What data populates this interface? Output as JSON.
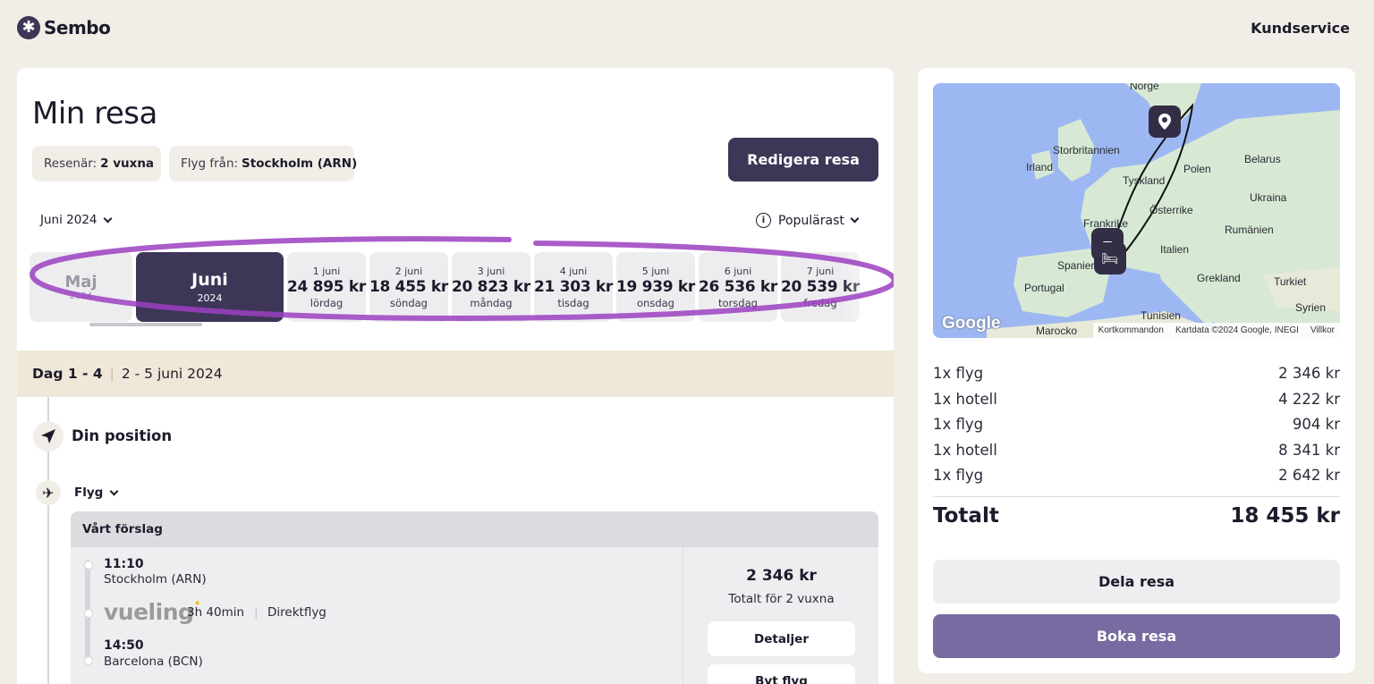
{
  "header": {
    "logo_text": "Sembo",
    "customer_service": "Kundservice"
  },
  "trip": {
    "title": "Min resa",
    "travelers_label": "Resenär:",
    "travelers_value": "2 vuxna",
    "from_label": "Flyg från:",
    "from_value": "Stockholm (ARN)",
    "edit_button": "Redigera resa",
    "month_select": "Juni 2024",
    "sort_select": "Populärast"
  },
  "date_strip": {
    "prev_month": {
      "name": "Maj",
      "year": "2024"
    },
    "current_month": {
      "name": "Juni",
      "year": "2024"
    },
    "days": [
      {
        "date": "1 juni",
        "price": "24 895 kr",
        "weekday": "lördag"
      },
      {
        "date": "2 juni",
        "price": "18 455 kr",
        "weekday": "söndag"
      },
      {
        "date": "3 juni",
        "price": "20 823 kr",
        "weekday": "måndag"
      },
      {
        "date": "4 juni",
        "price": "21 303 kr",
        "weekday": "tisdag"
      },
      {
        "date": "5 juni",
        "price": "19 939 kr",
        "weekday": "onsdag"
      },
      {
        "date": "6 juni",
        "price": "26 536 kr",
        "weekday": "torsdag"
      },
      {
        "date": "7 juni",
        "price": "20 539 kr",
        "weekday": "fredag"
      }
    ]
  },
  "day_section": {
    "days": "Dag 1 - 4",
    "dates": "2 - 5 juni 2024",
    "position_label": "Din position",
    "flight_label": "Flyg"
  },
  "flight": {
    "suggestion_title": "Vårt förslag",
    "departure_time": "11:10",
    "departure_place": "Stockholm (ARN)",
    "airline": "vueling",
    "duration": "3h 40min",
    "type": "Direktflyg",
    "arrival_time": "14:50",
    "arrival_place": "Barcelona (BCN)",
    "price": "2 346 kr",
    "price_note": "Totalt för 2 vuxna",
    "details_button": "Detaljer",
    "swap_button": "Byt flyg"
  },
  "map": {
    "countries": [
      "Norge",
      "Storbritannien",
      "Irland",
      "Tyskland",
      "Polen",
      "Belarus",
      "Ukraina",
      "Österrike",
      "Frankrike",
      "Rumänien",
      "Italien",
      "Spanien",
      "Portugal",
      "Grekland",
      "Turkiet",
      "Tunisien",
      "Syrien",
      "Marocko"
    ],
    "google_label": "Google",
    "shortcuts": "Kortkommandon",
    "map_data": "Kartdata ©2024 Google, INEGI",
    "terms": "Villkor"
  },
  "summary": {
    "items": [
      {
        "label": "1x flyg",
        "price": "2 346 kr"
      },
      {
        "label": "1x hotell",
        "price": "4 222 kr"
      },
      {
        "label": "1x flyg",
        "price": "904 kr"
      },
      {
        "label": "1x hotell",
        "price": "8 341 kr"
      },
      {
        "label": "1x flyg",
        "price": "2 642 kr"
      }
    ],
    "total_label": "Totalt",
    "total_value": "18 455 kr",
    "share_button": "Dela resa",
    "book_button": "Boka resa"
  },
  "colors": {
    "brand": "#3d3657",
    "book_button": "#786ba1",
    "background": "#f1eee7",
    "day_bar": "#efe8d8",
    "highlight": "#9b3fbf"
  }
}
